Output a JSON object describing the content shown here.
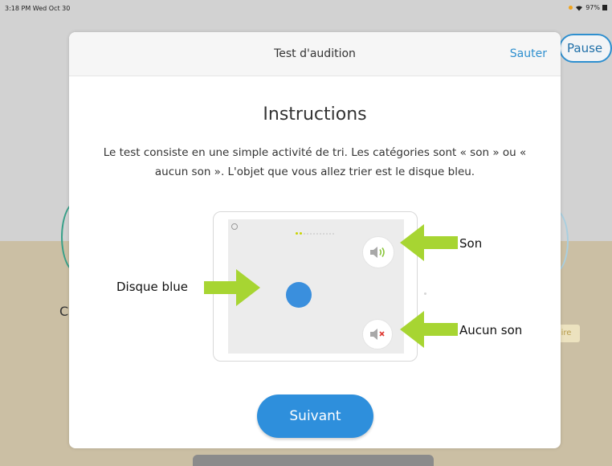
{
  "status_bar": {
    "time": "3:18 PM  Wed Oct 30",
    "battery": "97%"
  },
  "background": {
    "pause_label": "Pause",
    "partial_letter": "C",
    "partial_chip": "ire"
  },
  "modal": {
    "title": "Test d'audition",
    "skip_label": "Sauter",
    "heading": "Instructions",
    "description": "Le test consiste en une simple activité de tri. Les catégories sont « son » ou « aucun son ». L'objet que vous allez trier est le disque bleu.",
    "illustration": {
      "label_disc": "Disque blue",
      "label_sound": "Son",
      "label_no_sound": "Aucun son",
      "icons": [
        "speaker-sound-icon",
        "speaker-muted-icon",
        "blue-disc"
      ]
    },
    "next_label": "Suivant"
  },
  "colors": {
    "accent": "#2e8fdc",
    "arrow": "#a7d532",
    "mute_x": "#e0403a",
    "disc": "#3a8fdd"
  }
}
